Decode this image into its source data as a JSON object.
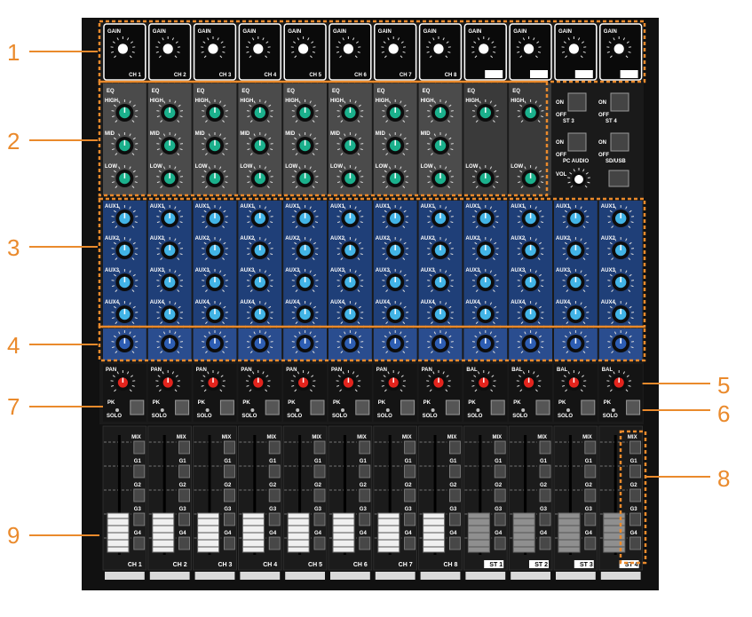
{
  "callouts": [
    "1",
    "2",
    "3",
    "4",
    "5",
    "6",
    "7",
    "8",
    "9"
  ],
  "channels": [
    "CH 1",
    "CH 2",
    "CH 3",
    "CH 4",
    "CH 5",
    "CH 6",
    "CH 7",
    "CH 8",
    "ST 1",
    "ST 2",
    "ST 3",
    "ST 4"
  ],
  "gain_top_label": "GAIN",
  "gain_channel_labels": [
    "CH 1",
    "CH 2",
    "CH 3",
    "CH 4",
    "CH 5",
    "CH 6",
    "CH 7",
    "CH 8",
    "ST 1",
    "ST 2",
    "ST 3",
    "ST 4"
  ],
  "eq": {
    "title": "EQ",
    "bands": [
      "HIGH",
      "MID",
      "LOW"
    ]
  },
  "aux_labels": [
    "AUX1",
    "AUX2",
    "AUX3",
    "AUX4"
  ],
  "pan_labels": [
    "PAN",
    "PAN",
    "PAN",
    "PAN",
    "PAN",
    "PAN",
    "PAN",
    "PAN",
    "BAL",
    "BAL",
    "BAL",
    "BAL"
  ],
  "pk_label": "PK",
  "solo_label": "SOLO",
  "switch_labels": [
    "ST 3",
    "ST 4",
    "PC AUDIO",
    "SD/USB"
  ],
  "on_label": "ON",
  "off_label": "OFF",
  "vol_label": "VOL",
  "routing_labels": [
    "MIX",
    "G1",
    "G2",
    "G3",
    "G4"
  ],
  "colors": {
    "callout": "#ea8a2c",
    "eq_knob": "#1bb08c",
    "aux_knob": "#42b4e6",
    "pan_knob": "#e3241d",
    "panel": "#161616",
    "eq_panel": "#4b4b4b",
    "aux_panel": "#1f3f78"
  }
}
